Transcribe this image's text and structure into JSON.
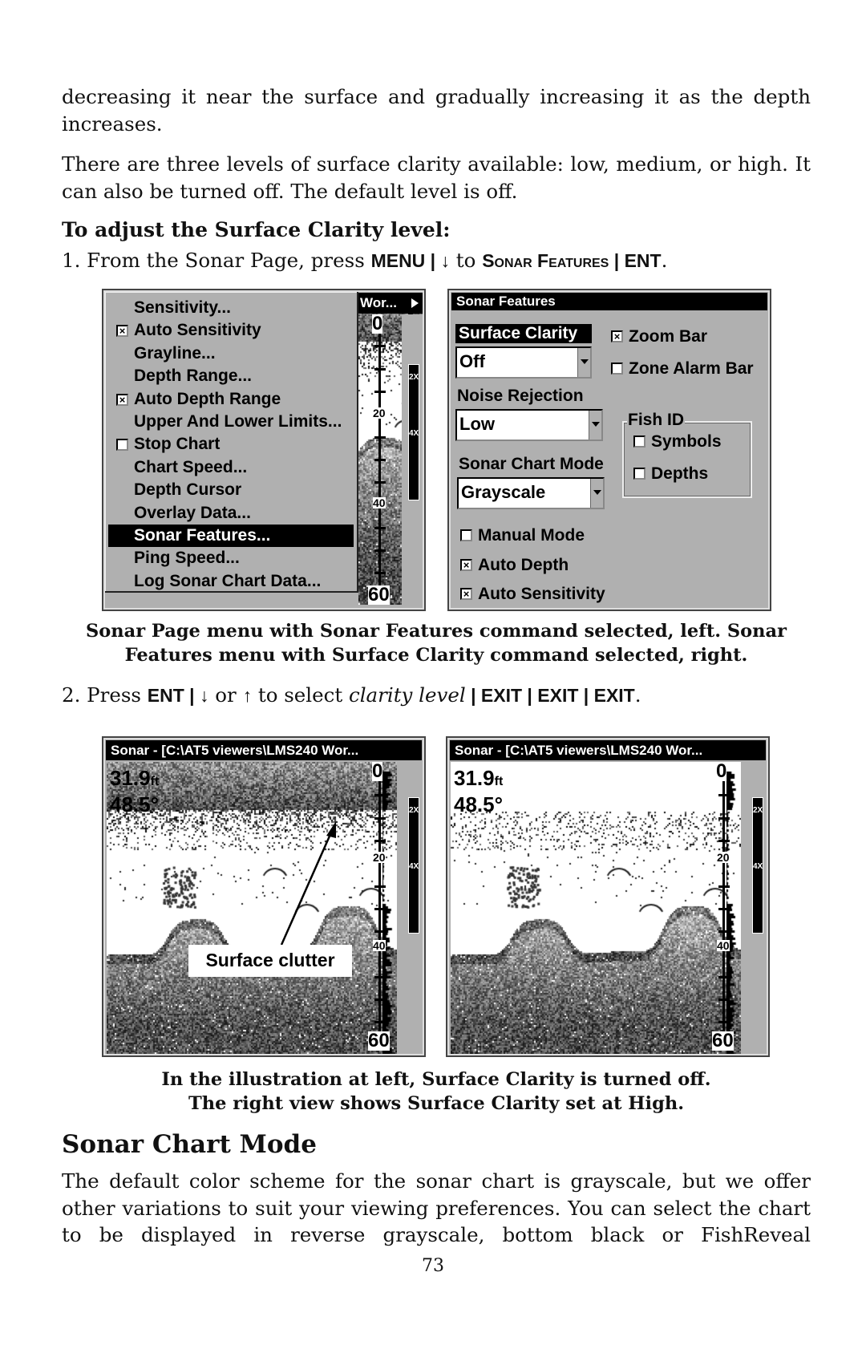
{
  "text": {
    "para1": "decreasing it near the surface and gradually increasing it as the depth increases.",
    "para2": "There are three levels of surface clarity available: low, medium, or high. It can also be turned off. The default level is off.",
    "procedure_heading": "To adjust the Surface Clarity level:",
    "step1": {
      "prefix": "1. From the Sonar Page, press ",
      "menu": "MENU",
      "sep": " | ",
      "arrow": "↓",
      "to": " to ",
      "sonar_features": "Sonar Features",
      "ent": "ENT",
      "end": "."
    },
    "caption1": "Sonar Page menu with Sonar Features command selected, left. Sonar Features menu with Surface Clarity command selected, right.",
    "step2": {
      "prefix": "2. Press ",
      "ent": "ENT",
      "sep": " | ",
      "down": "↓",
      "or": " or ",
      "up": "↑",
      "select": " to select ",
      "level": "clarity level",
      "exit": "EXIT",
      "end": "."
    },
    "caption2_line1": "In the illustration at left, Surface Clarity is turned off.",
    "caption2_line2": "The right view shows Surface Clarity set at High.",
    "section_heading": "Sonar Chart Mode",
    "para3": "The default color scheme for the sonar chart is grayscale, but we offer other variations to suit your viewing preferences. You can select the chart to be displayed in reverse grayscale, bottom black or FishReveal",
    "page_number": "73"
  },
  "sonar_menu": {
    "window_title_fragment": "Wor...",
    "scroll_arrow_icon": "triangle-right-icon",
    "items": [
      {
        "label": "Sensitivity...",
        "checkbox": null
      },
      {
        "label": "Auto Sensitivity",
        "checkbox": true
      },
      {
        "label": "Grayline...",
        "checkbox": null
      },
      {
        "label": "Depth Range...",
        "checkbox": null
      },
      {
        "label": "Auto Depth Range",
        "checkbox": true
      },
      {
        "label": "Upper And Lower Limits...",
        "checkbox": null
      },
      {
        "label": "Stop Chart",
        "checkbox": false
      },
      {
        "label": "Chart Speed...",
        "checkbox": null
      },
      {
        "label": "Depth Cursor",
        "checkbox": null
      },
      {
        "label": "Overlay Data...",
        "checkbox": null
      },
      {
        "label": "Sonar Features...",
        "checkbox": null,
        "selected": true
      },
      {
        "label": "Ping Speed...",
        "checkbox": null
      },
      {
        "label": "Log Sonar Chart Data...",
        "checkbox": null
      }
    ],
    "depth_labels": [
      "0",
      "20",
      "40",
      "60"
    ],
    "zoom_labels": [
      "2X",
      "4X"
    ]
  },
  "sonar_features": {
    "title": "Sonar Features",
    "surface_clarity_label": "Surface Clarity",
    "surface_clarity_value": "Off",
    "noise_rejection_label": "Noise Rejection",
    "noise_rejection_value": "Low",
    "chart_mode_label": "Sonar Chart Mode",
    "chart_mode_value": "Grayscale",
    "zoom_bar": {
      "label": "Zoom Bar",
      "checked": true
    },
    "zone_alarm_bar": {
      "label": "Zone Alarm Bar",
      "checked": false
    },
    "fish_id_label": "Fish ID",
    "symbols": {
      "label": "Symbols",
      "checked": false
    },
    "depths": {
      "label": "Depths",
      "checked": false
    },
    "manual_mode": {
      "label": "Manual Mode",
      "checked": false
    },
    "auto_depth": {
      "label": "Auto Depth",
      "checked": true
    },
    "auto_sensitivity": {
      "label": "Auto Sensitivity",
      "checked": true
    }
  },
  "sonar_views": [
    {
      "title": "Sonar - [C:\\AT5 viewers\\LMS240 Wor...",
      "depth": "31.9",
      "depth_unit": "ft",
      "temp": "48.5°",
      "surface_clarity": "Off",
      "callout": "Surface clutter"
    },
    {
      "title": "Sonar - [C:\\AT5 viewers\\LMS240 Wor...",
      "depth": "31.9",
      "depth_unit": "ft",
      "temp": "48.5°",
      "surface_clarity": "High"
    }
  ],
  "depth_scale": [
    "0",
    "20",
    "40",
    "60"
  ],
  "zoom_labels": [
    "2X",
    "4X"
  ],
  "colors": {
    "panel_gray": "#b0b0b0",
    "highlight": "#000000",
    "highlight_text": "#ffffff"
  }
}
